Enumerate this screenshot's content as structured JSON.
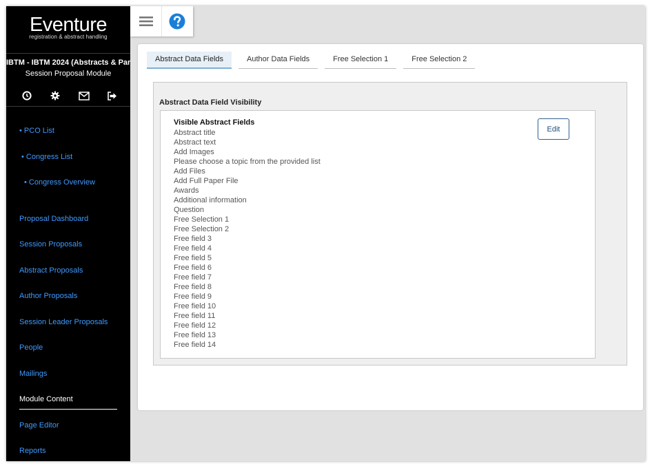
{
  "brand": {
    "name": "Eventure",
    "tagline": "registration & abstract handling"
  },
  "sidebar": {
    "event_title": "IBTM - IBTM 2024 (Abstracts & Par…",
    "module_name": "Session Proposal Module",
    "icons": [
      "clock-icon",
      "gear-icon",
      "mail-icon",
      "logout-icon"
    ],
    "breadcrumbs": [
      {
        "label": "• PCO List"
      },
      {
        "label": "• Congress List"
      },
      {
        "label": "• Congress Overview"
      }
    ],
    "items": [
      {
        "label": "Proposal Dashboard"
      },
      {
        "label": "Session Proposals"
      },
      {
        "label": "Abstract Proposals"
      },
      {
        "label": "Author Proposals"
      },
      {
        "label": "Session Leader Proposals"
      },
      {
        "label": "People"
      },
      {
        "label": "Mailings"
      },
      {
        "label": "Module Content",
        "active": true
      },
      {
        "label": "Page Editor"
      },
      {
        "label": "Reports"
      }
    ]
  },
  "topbar": {
    "icons": [
      "hamburger-menu-icon",
      "help-icon"
    ]
  },
  "tabs": [
    {
      "label": "Abstract Data Fields",
      "active": true
    },
    {
      "label": "Author Data Fields"
    },
    {
      "label": "Free Selection 1"
    },
    {
      "label": "Free Selection 2"
    }
  ],
  "section": {
    "title": "Abstract Data Field Visibility",
    "heading": "Visible Abstract Fields",
    "edit_label": "Edit",
    "fields": [
      "Abstract title",
      "Abstract text",
      "Add Images",
      "Please choose a topic from the provided list",
      "Add Files",
      "Add Full Paper File",
      "Awards",
      "Additional information",
      "Question",
      "Free Selection 1",
      "Free Selection 2",
      "Free field 3",
      "Free field 4",
      "Free field 5",
      "Free field 6",
      "Free field 7",
      "Free field 8",
      "Free field 9",
      "Free field 10",
      "Free field 11",
      "Free field 12",
      "Free field 13",
      "Free field 14"
    ]
  },
  "colors": {
    "sidebar_bg": "#000000",
    "nav_link": "#3f9aff",
    "accent": "#1d4f80",
    "help_icon": "#1a7fd8"
  }
}
